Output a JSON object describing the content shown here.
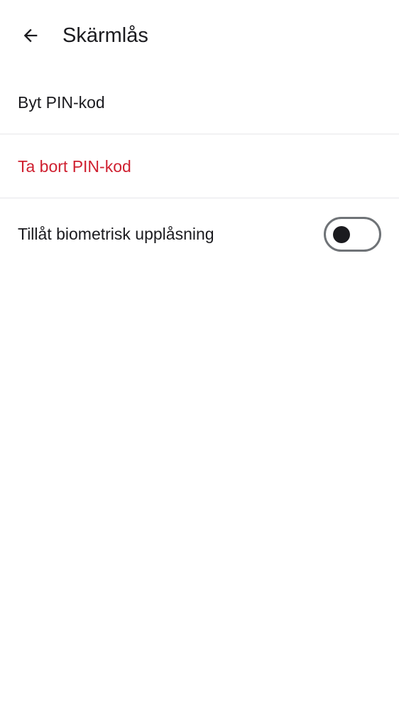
{
  "app_bar": {
    "back_icon": "arrow-left-icon",
    "title": "Skärmlås"
  },
  "settings": {
    "change_pin_label": "Byt PIN-kod",
    "remove_pin_label": "Ta bort PIN-kod",
    "biometric_label": "Tillåt biometrisk upplåsning",
    "biometric_enabled": false
  },
  "colors": {
    "text": "#1b1b1f",
    "danger": "#cf2030",
    "divider": "#e6e6ea",
    "switch_outline": "#6f7377"
  }
}
